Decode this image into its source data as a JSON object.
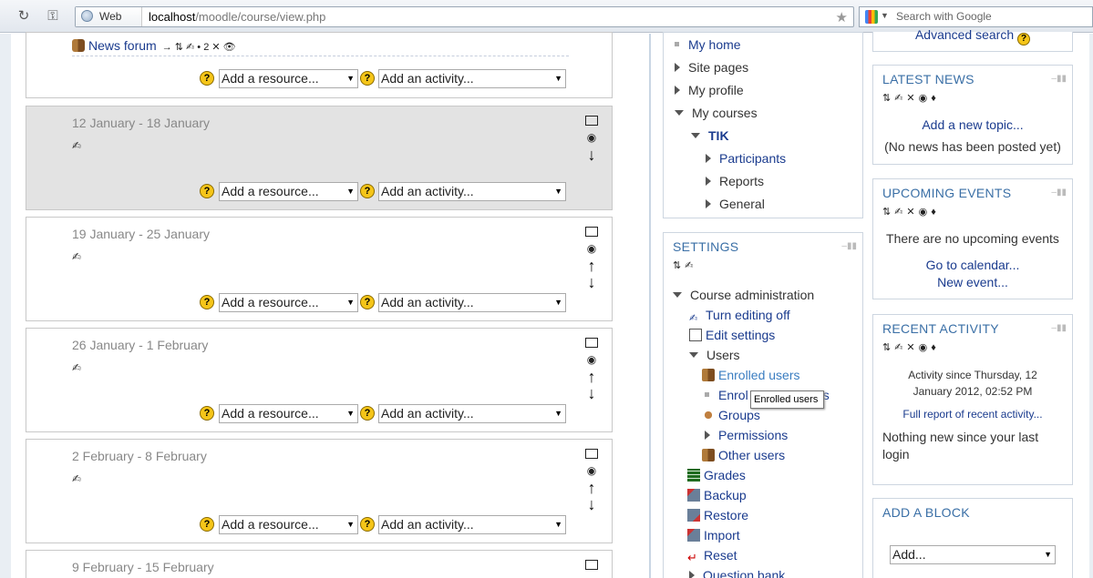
{
  "browser": {
    "site_label": "Web",
    "url_host": "localhost",
    "url_path": "/moodle/course/view.php",
    "search_placeholder": "Search with Google"
  },
  "add": {
    "resource": "Add a resource...",
    "activity": "Add an activity...",
    "help": "?"
  },
  "sections": [
    {
      "title": "",
      "forum": "News forum",
      "forum_icons": "→ ⇅ ✍ • 2 ✕ 👁"
    },
    {
      "title": "12 January - 18 January"
    },
    {
      "title": "19 January - 25 January"
    },
    {
      "title": "26 January - 1 February"
    },
    {
      "title": "2 February - 8 February"
    },
    {
      "title": "9 February - 15 February"
    }
  ],
  "nav": {
    "my_home": "My home",
    "site_pages": "Site pages",
    "my_profile": "My profile",
    "my_courses": "My courses",
    "course": "TIK",
    "participants": "Participants",
    "reports": "Reports",
    "general": "General"
  },
  "settings": {
    "heading": "SETTINGS",
    "course_admin": "Course administration",
    "turn_editing_off": "Turn editing off",
    "edit_settings": "Edit settings",
    "users": "Users",
    "enrolled_users": "Enrolled users",
    "enrolment_methods_partial": "Enrol",
    "enrolment_methods_tail": "s",
    "groups": "Groups",
    "permissions": "Permissions",
    "other_users": "Other users",
    "grades": "Grades",
    "backup": "Backup",
    "restore": "Restore",
    "import": "Import",
    "reset": "Reset",
    "question_bank": "Question bank",
    "tooltip": "Enrolled users"
  },
  "right": {
    "advanced_search": "Advanced search",
    "latest_news": {
      "heading": "LATEST NEWS",
      "add_topic": "Add a new topic...",
      "none": "(No news has been posted yet)"
    },
    "upcoming": {
      "heading": "UPCOMING EVENTS",
      "none": "There are no upcoming events",
      "goto": "Go to calendar...",
      "new_event": "New event..."
    },
    "recent": {
      "heading": "RECENT ACTIVITY",
      "since_1": "Activity since Thursday, 12",
      "since_2": "January 2012, 02:52 PM",
      "full_report": "Full report of recent activity...",
      "nothing_1": "Nothing new since your last",
      "nothing_2": "login"
    },
    "add_block": {
      "heading": "ADD A BLOCK",
      "select": "Add..."
    }
  }
}
